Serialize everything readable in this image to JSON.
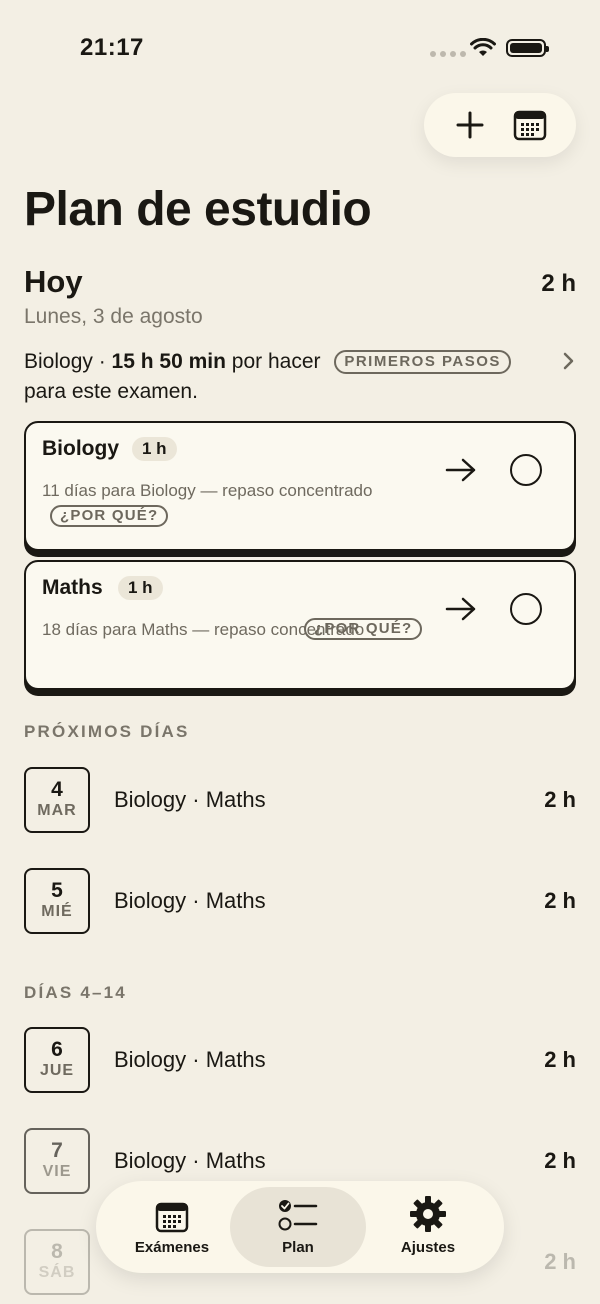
{
  "status_bar": {
    "time": "21:17"
  },
  "header": {
    "add_icon": "plus-icon",
    "calendar_icon": "calendar-icon"
  },
  "page_title": "Plan de estudio",
  "today": {
    "heading": "Hoy",
    "total_hours": "2 h",
    "date": "Lunes, 3 de agosto",
    "summary_subject": "Biology ·",
    "summary_time": "15 h 50 min",
    "summary_suffix": "por hacer",
    "summary_line2": "para este examen.",
    "badge": "PRIMEROS PASOS"
  },
  "tasks": [
    {
      "subject": "Biology",
      "hours": "1 h",
      "desc": "11 días para Biology — repaso concentrado",
      "why": "¿POR QUÉ?"
    },
    {
      "subject": "Maths",
      "hours": "1 h",
      "desc": "18 días para Maths — repaso concentrado",
      "why": "¿POR QUÉ?"
    }
  ],
  "upcoming": {
    "label": "PRÓXIMOS DÍAS",
    "days": [
      {
        "num": "4",
        "weekday": "MAR",
        "subjects": "Biology · Maths",
        "hours": "2 h"
      },
      {
        "num": "5",
        "weekday": "MIÉ",
        "subjects": "Biology · Maths",
        "hours": "2 h"
      }
    ]
  },
  "later": {
    "label": "DÍAS 4–14",
    "days": [
      {
        "num": "6",
        "weekday": "JUE",
        "subjects": "Biology · Maths",
        "hours": "2 h"
      },
      {
        "num": "7",
        "weekday": "VIE",
        "subjects": "Biology · Maths",
        "hours": "2 h"
      },
      {
        "num": "8",
        "weekday": "SÁB",
        "subjects": "",
        "hours": "2 h"
      }
    ]
  },
  "tabbar": {
    "tabs": [
      {
        "label": "Exámenes",
        "icon": "calendar-icon"
      },
      {
        "label": "Plan",
        "icon": "checklist-icon",
        "active": true
      },
      {
        "label": "Ajustes",
        "icon": "gear-icon"
      }
    ]
  }
}
